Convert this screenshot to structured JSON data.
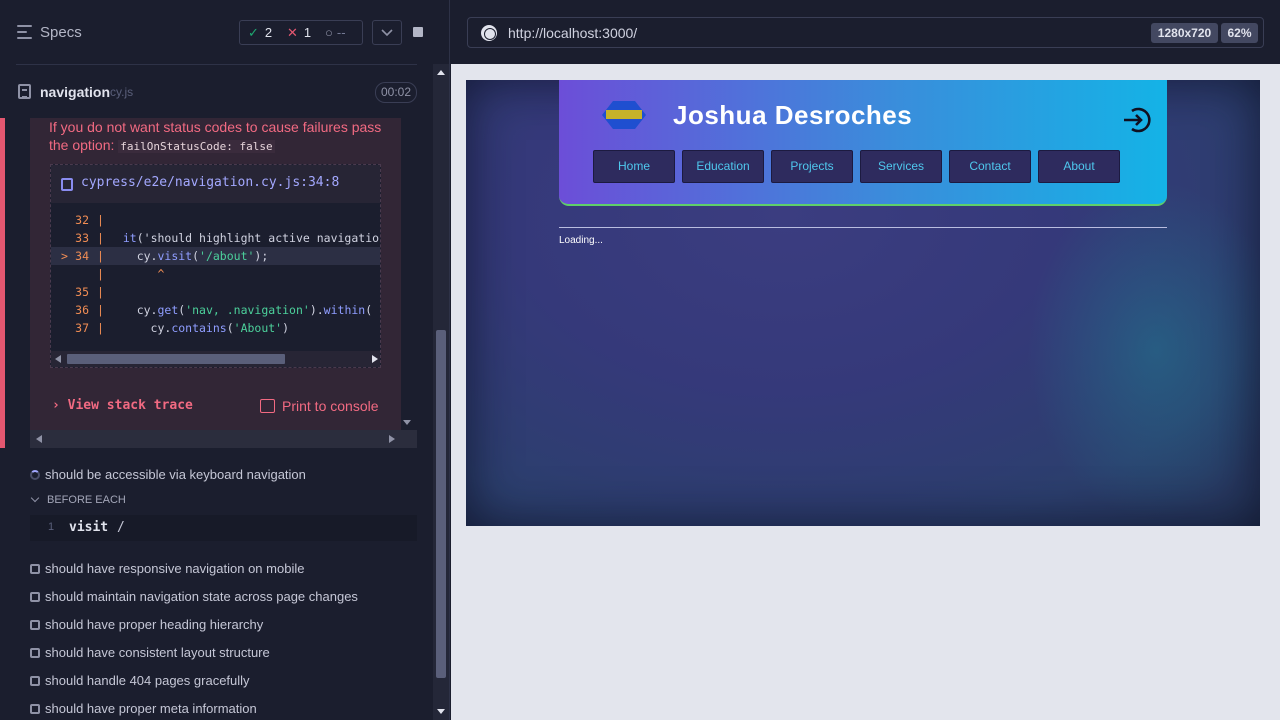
{
  "runner": {
    "header": {
      "specs_label": "Specs",
      "passed_icon": "✓",
      "passed_count": "2",
      "failed_icon": "✕",
      "failed_count": "1",
      "pending_icon": "○",
      "pending_count": "--"
    },
    "spec_file": {
      "name": "navigation",
      "ext": "cy.js",
      "duration": "00:02"
    },
    "error": {
      "message": "If you do not want status codes to cause failures pass the option:",
      "option_code": "failOnStatusCode: false",
      "frame_file": "cypress/e2e/navigation.cy.js:34:8",
      "lines": [
        {
          "num": "32",
          "marker": "",
          "code": ""
        },
        {
          "num": "33",
          "marker": "",
          "code": "  it('should highlight active navigation"
        },
        {
          "num": "34",
          "marker": ">",
          "code": "    cy.visit('/about');"
        },
        {
          "num": "",
          "marker": "",
          "code": "       ^"
        },
        {
          "num": "35",
          "marker": "",
          "code": ""
        },
        {
          "num": "36",
          "marker": "",
          "code": "    cy.get('nav, .navigation').within("
        },
        {
          "num": "37",
          "marker": "",
          "code": "      cy.contains('About')"
        }
      ],
      "view_stack_trace": "View stack trace",
      "print_to_console": "Print to console"
    },
    "running_test": "should be accessible via keyboard navigation",
    "before_each_label": "BEFORE EACH",
    "command": {
      "num": "1",
      "name": "visit",
      "arg": "/"
    },
    "pending_tests": [
      "should have responsive navigation on mobile",
      "should maintain navigation state across page changes",
      "should have proper heading hierarchy",
      "should have consistent layout structure",
      "should handle 404 pages gracefully",
      "should have proper meta information"
    ]
  },
  "aut": {
    "url": "http://localhost:3000/",
    "viewport": "1280x720",
    "zoom": "62%",
    "site": {
      "title": "Joshua Desroches",
      "nav": [
        "Home",
        "Education",
        "Projects",
        "Services",
        "Contact",
        "About"
      ],
      "loading": "Loading..."
    }
  },
  "colors": {
    "pass": "#1fa971",
    "fail": "#e45770",
    "accent": "#a3a8ff",
    "header_gradient_start": "#6c4ed8",
    "header_gradient_end": "#14b3e6",
    "nav_text": "#4fc8ee"
  }
}
